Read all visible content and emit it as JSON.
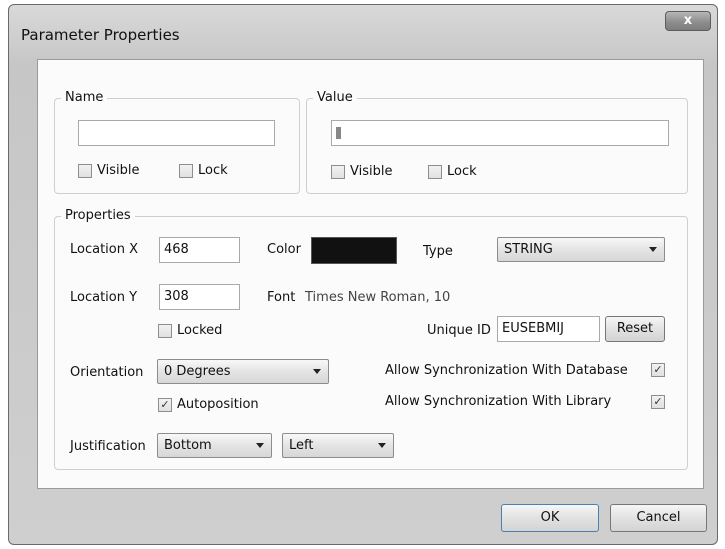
{
  "window": {
    "title": "Parameter Properties",
    "close_glyph": "x"
  },
  "name_group": {
    "legend": "Name",
    "input_value": "",
    "visible_label": "Visible",
    "visible_checked": false,
    "lock_label": "Lock",
    "lock_checked": false
  },
  "value_group": {
    "legend": "Value",
    "input_value": "",
    "visible_label": "Visible",
    "visible_checked": false,
    "lock_label": "Lock",
    "lock_checked": false
  },
  "properties": {
    "legend": "Properties",
    "location_x_label": "Location  X",
    "location_x_value": "468",
    "location_y_label": "Location  Y",
    "location_y_value": "308",
    "color_label": "Color",
    "color_value": "#111111",
    "type_label": "Type",
    "type_value": "STRING",
    "font_label": "Font",
    "font_value": "Times New Roman, 10",
    "locked_label": "Locked",
    "locked_checked": false,
    "unique_id_label": "Unique ID",
    "unique_id_value": "EUSEBMIJ",
    "reset_label": "Reset",
    "orientation_label": "Orientation",
    "orientation_value": "0 Degrees",
    "autoposition_label": "Autoposition",
    "autoposition_checked": true,
    "sync_db_label": "Allow Synchronization With Database",
    "sync_db_checked": true,
    "sync_lib_label": "Allow Synchronization With Library",
    "sync_lib_checked": true,
    "justification_label": "Justification",
    "justification_vertical": "Bottom",
    "justification_horizontal": "Left"
  },
  "buttons": {
    "ok": "OK",
    "cancel": "Cancel"
  },
  "icons": {
    "check": "✓"
  }
}
